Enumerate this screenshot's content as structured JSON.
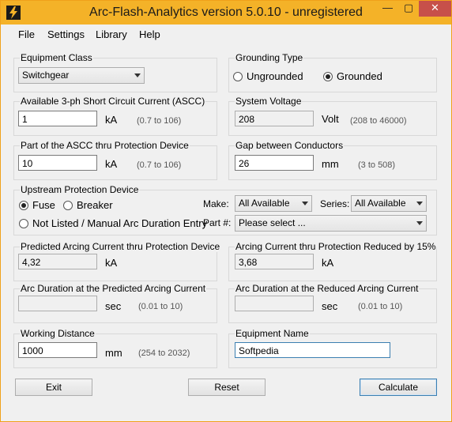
{
  "window": {
    "title": "Arc-Flash-Analytics version 5.0.10 - unregistered",
    "controls": {
      "minimize": "—",
      "maximize": "▢",
      "close": "✕"
    },
    "accent_color": "#f4b228",
    "close_color": "#c7504a"
  },
  "menu": {
    "items": [
      "File",
      "Settings",
      "Library",
      "Help"
    ]
  },
  "equipment_class": {
    "label": "Equipment Class",
    "selected": "Switchgear"
  },
  "grounding": {
    "label": "Grounding Type",
    "options": [
      "Ungrounded",
      "Grounded"
    ],
    "selected": "Grounded"
  },
  "ascc": {
    "label": "Available 3-ph Short Circuit Current (ASCC)",
    "value": "1",
    "unit": "kA",
    "range": "(0.7 to 106)"
  },
  "system_voltage": {
    "label": "System Voltage",
    "value": "208",
    "unit": "Volt",
    "range": "(208 to 46000)"
  },
  "ascc_part": {
    "label": "Part of the ASCC thru Protection Device",
    "value": "10",
    "unit": "kA",
    "range": "(0.7 to 106)"
  },
  "gap": {
    "label": "Gap between Conductors",
    "value": "26",
    "unit": "mm",
    "range": "(3 to 508)"
  },
  "upstream": {
    "label": "Upstream Protection Device",
    "options": [
      "Fuse",
      "Breaker",
      "Not Listed / Manual Arc Duration Entry"
    ],
    "selected": "Fuse",
    "make_label": "Make:",
    "make_value": "All Available",
    "series_label": "Series:",
    "series_value": "All Available",
    "part_label": "Part #:",
    "part_value": "Please select ..."
  },
  "predicted_current": {
    "label": "Predicted Arcing Current thru Protection Device",
    "value": "4,32",
    "unit": "kA"
  },
  "reduced_current": {
    "label": "Arcing Current thru Protection Reduced by 15%",
    "value": "3,68",
    "unit": "kA"
  },
  "arc_duration_predicted": {
    "label": "Arc Duration at the Predicted Arcing Current",
    "value": "",
    "unit": "sec",
    "range": "(0.01 to 10)"
  },
  "arc_duration_reduced": {
    "label": "Arc Duration at the Reduced Arcing Current",
    "value": "",
    "unit": "sec",
    "range": "(0.01 to 10)"
  },
  "working_distance": {
    "label": "Working Distance",
    "value": "1000",
    "unit": "mm",
    "range": "(254 to 2032)"
  },
  "equipment_name": {
    "label": "Equipment Name",
    "value": "Softpedia"
  },
  "buttons": {
    "exit": "Exit",
    "reset": "Reset",
    "calculate": "Calculate"
  }
}
